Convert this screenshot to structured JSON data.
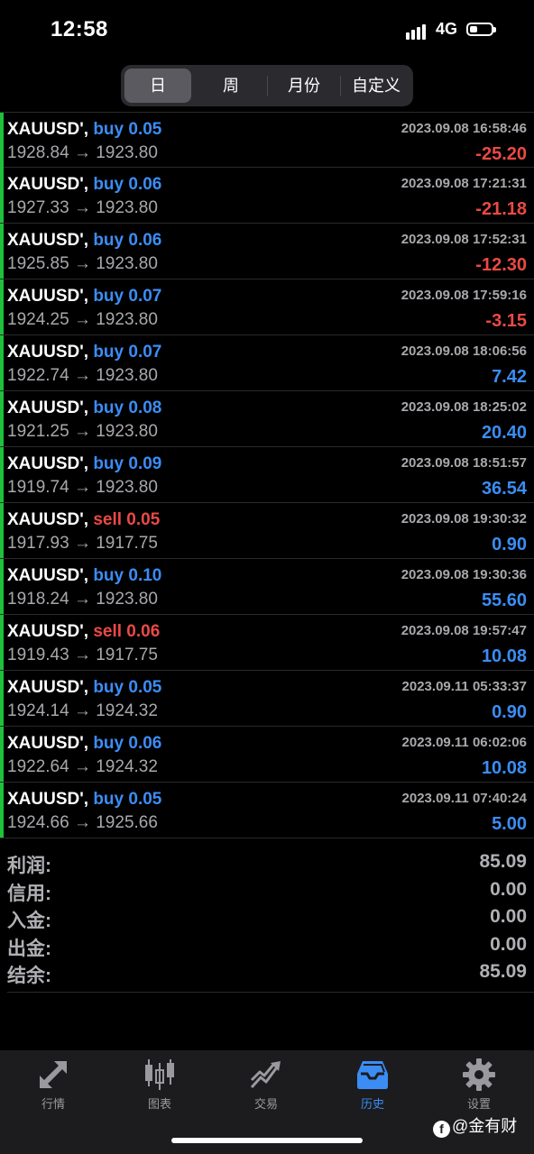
{
  "status": {
    "time": "12:58",
    "network": "4G"
  },
  "segments": [
    {
      "label": "日",
      "active": true
    },
    {
      "label": "周",
      "active": false
    },
    {
      "label": "月份",
      "active": false
    },
    {
      "label": "自定义",
      "active": false
    }
  ],
  "trades": [
    {
      "symbol": "XAUUSD',",
      "side": "buy",
      "volume": "0.05",
      "datetime": "2023.09.08 16:58:46",
      "prices": "1928.84 → 1923.80",
      "profit": "-25.20"
    },
    {
      "symbol": "XAUUSD',",
      "side": "buy",
      "volume": "0.06",
      "datetime": "2023.09.08 17:21:31",
      "prices": "1927.33 → 1923.80",
      "profit": "-21.18"
    },
    {
      "symbol": "XAUUSD',",
      "side": "buy",
      "volume": "0.06",
      "datetime": "2023.09.08 17:52:31",
      "prices": "1925.85 → 1923.80",
      "profit": "-12.30"
    },
    {
      "symbol": "XAUUSD',",
      "side": "buy",
      "volume": "0.07",
      "datetime": "2023.09.08 17:59:16",
      "prices": "1924.25 → 1923.80",
      "profit": "-3.15"
    },
    {
      "symbol": "XAUUSD',",
      "side": "buy",
      "volume": "0.07",
      "datetime": "2023.09.08 18:06:56",
      "prices": "1922.74 → 1923.80",
      "profit": "7.42"
    },
    {
      "symbol": "XAUUSD',",
      "side": "buy",
      "volume": "0.08",
      "datetime": "2023.09.08 18:25:02",
      "prices": "1921.25 → 1923.80",
      "profit": "20.40"
    },
    {
      "symbol": "XAUUSD',",
      "side": "buy",
      "volume": "0.09",
      "datetime": "2023.09.08 18:51:57",
      "prices": "1919.74 → 1923.80",
      "profit": "36.54"
    },
    {
      "symbol": "XAUUSD',",
      "side": "sell",
      "volume": "0.05",
      "datetime": "2023.09.08 19:30:32",
      "prices": "1917.93 → 1917.75",
      "profit": "0.90"
    },
    {
      "symbol": "XAUUSD',",
      "side": "buy",
      "volume": "0.10",
      "datetime": "2023.09.08 19:30:36",
      "prices": "1918.24 → 1923.80",
      "profit": "55.60"
    },
    {
      "symbol": "XAUUSD',",
      "side": "sell",
      "volume": "0.06",
      "datetime": "2023.09.08 19:57:47",
      "prices": "1919.43 → 1917.75",
      "profit": "10.08"
    },
    {
      "symbol": "XAUUSD',",
      "side": "buy",
      "volume": "0.05",
      "datetime": "2023.09.11 05:33:37",
      "prices": "1924.14 → 1924.32",
      "profit": "0.90"
    },
    {
      "symbol": "XAUUSD',",
      "side": "buy",
      "volume": "0.06",
      "datetime": "2023.09.11 06:02:06",
      "prices": "1922.64 → 1924.32",
      "profit": "10.08"
    },
    {
      "symbol": "XAUUSD',",
      "side": "buy",
      "volume": "0.05",
      "datetime": "2023.09.11 07:40:24",
      "prices": "1924.66 → 1925.66",
      "profit": "5.00"
    }
  ],
  "summary": [
    {
      "label": "利润:",
      "value": "85.09"
    },
    {
      "label": "信用:",
      "value": "0.00"
    },
    {
      "label": "入金:",
      "value": "0.00"
    },
    {
      "label": "出金:",
      "value": "0.00"
    },
    {
      "label": "结余:",
      "value": "85.09"
    }
  ],
  "tabs": [
    {
      "label": "行情",
      "icon": "quotes-arrows-icon",
      "active": false
    },
    {
      "label": "图表",
      "icon": "candlestick-chart-icon",
      "active": false
    },
    {
      "label": "交易",
      "icon": "trade-trend-icon",
      "active": false
    },
    {
      "label": "历史",
      "icon": "history-inbox-icon",
      "active": true
    },
    {
      "label": "设置",
      "icon": "settings-gear-icon",
      "active": false
    }
  ],
  "watermark": "@金有财",
  "colors": {
    "buy": "#3b8df5",
    "sell": "#ea4a44",
    "profit_pos": "#3b8df5",
    "profit_neg": "#ea4a44",
    "row_bar": "#1ec23a",
    "active_tab": "#3b8df5"
  }
}
